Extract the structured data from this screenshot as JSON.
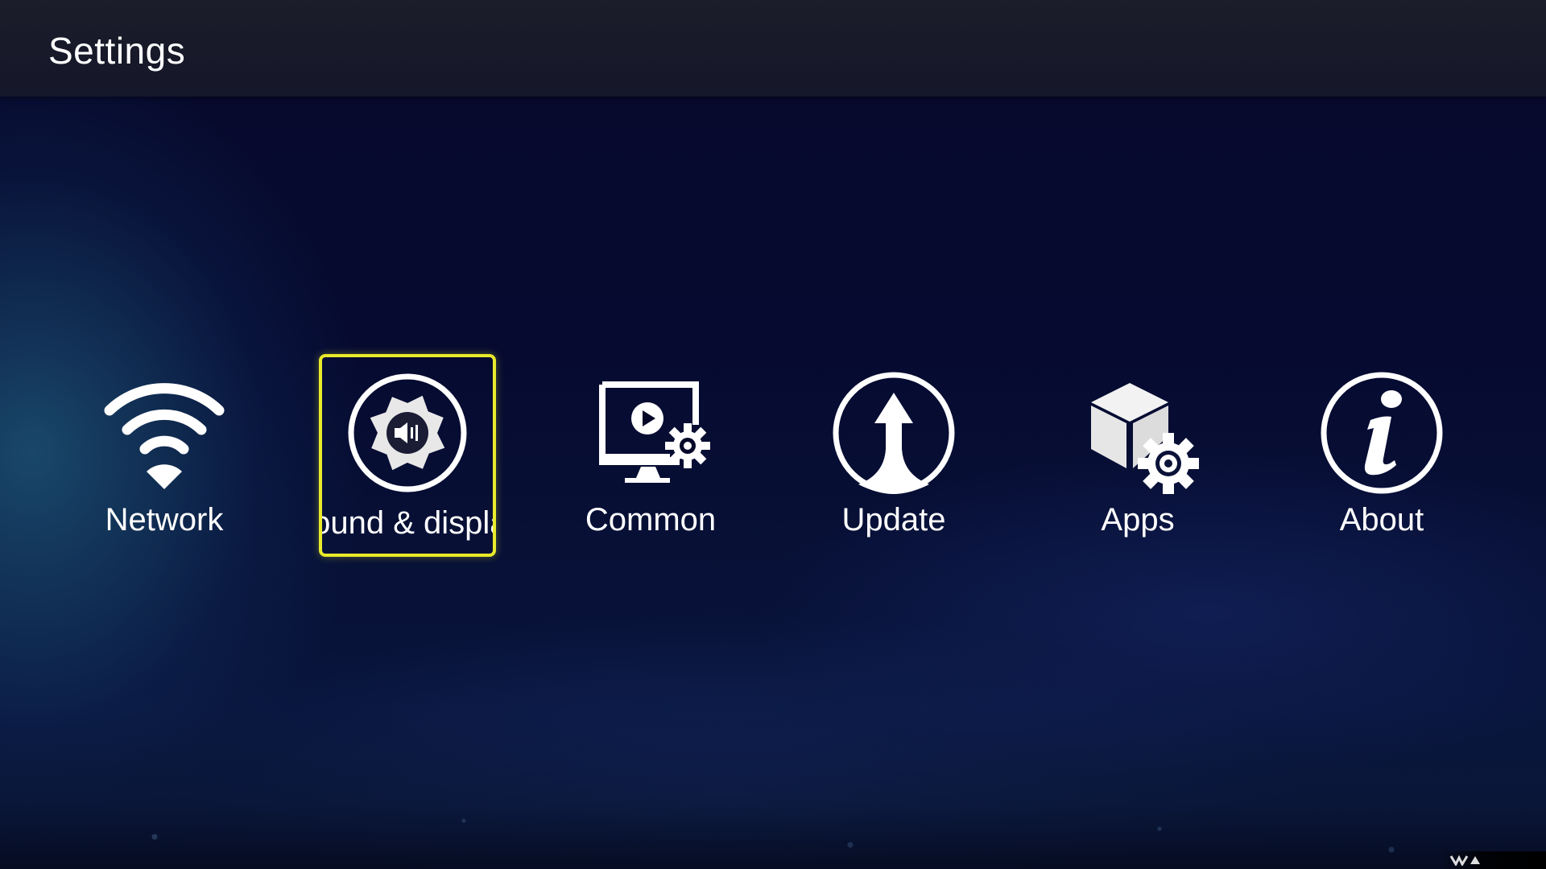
{
  "header": {
    "title": "Settings"
  },
  "menu": {
    "items": [
      {
        "id": "network",
        "label": "Network",
        "icon": "wifi-icon",
        "selected": false
      },
      {
        "id": "sound-display",
        "label": "Sound & display",
        "icon": "sound-display-icon",
        "selected": true
      },
      {
        "id": "common",
        "label": "Common",
        "icon": "monitor-settings-icon",
        "selected": false
      },
      {
        "id": "update",
        "label": "Update",
        "icon": "update-arrow-icon",
        "selected": false
      },
      {
        "id": "apps",
        "label": "Apps",
        "icon": "app-box-gear-icon",
        "selected": false
      },
      {
        "id": "about",
        "label": "About",
        "icon": "info-icon",
        "selected": false
      }
    ]
  },
  "colors": {
    "focus_border": "#e9ea2a",
    "text": "#ffffff",
    "background": "#050828",
    "topbar": "#1b1d2a"
  }
}
